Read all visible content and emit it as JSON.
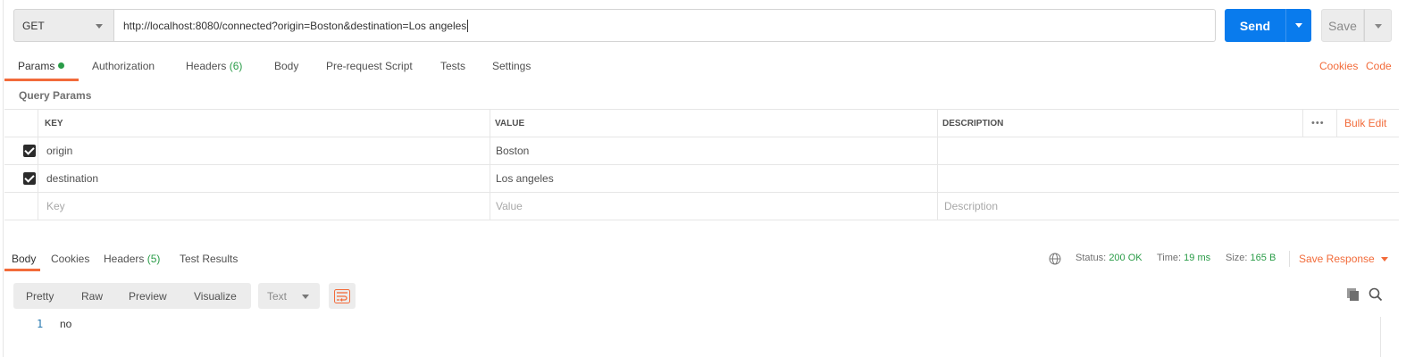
{
  "request": {
    "method": "GET",
    "url": "http://localhost:8080/connected?origin=Boston&destination=Los angeles",
    "send_label": "Send",
    "save_label": "Save"
  },
  "request_tabs": {
    "params": "Params",
    "authorization": "Authorization",
    "headers": "Headers",
    "headers_count": "(6)",
    "body": "Body",
    "prerequest": "Pre-request Script",
    "tests": "Tests",
    "settings": "Settings",
    "cookies": "Cookies",
    "code": "Code"
  },
  "query_params": {
    "title": "Query Params",
    "columns": {
      "key": "KEY",
      "value": "VALUE",
      "description": "DESCRIPTION"
    },
    "bulk_edit": "Bulk Edit",
    "more": "•••",
    "rows": [
      {
        "key": "origin",
        "value": "Boston",
        "description": "",
        "checked": true
      },
      {
        "key": "destination",
        "value": "Los angeles",
        "description": "",
        "checked": true
      }
    ],
    "placeholders": {
      "key": "Key",
      "value": "Value",
      "description": "Description"
    }
  },
  "response_tabs": {
    "body": "Body",
    "cookies": "Cookies",
    "headers": "Headers",
    "headers_count": "(5)",
    "test_results": "Test Results"
  },
  "response_status": {
    "status_label": "Status:",
    "status_value": "200 OK",
    "time_label": "Time:",
    "time_value": "19 ms",
    "size_label": "Size:",
    "size_value": "165 B",
    "save_response": "Save Response"
  },
  "format_bar": {
    "pretty": "Pretty",
    "raw": "Raw",
    "preview": "Preview",
    "visualize": "Visualize",
    "text_type": "Text"
  },
  "response_body": {
    "lines": [
      {
        "number": "1",
        "text": "no"
      }
    ]
  },
  "colors": {
    "accent": "#f26b3a",
    "primary": "#097bed",
    "success": "#2a9c48"
  }
}
